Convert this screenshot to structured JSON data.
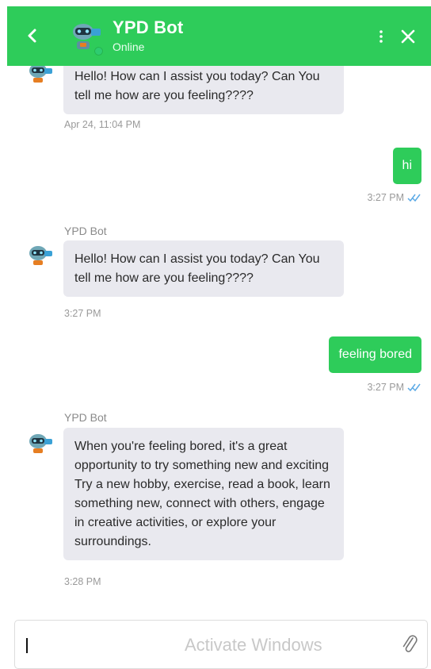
{
  "header": {
    "title": "YPD Bot",
    "status": "Online",
    "icons": {
      "back": "chevron-left-icon",
      "menu": "more-vertical-icon",
      "close": "close-icon",
      "avatar": "robot-avatar-icon"
    },
    "colors": {
      "header_bg": "#2ecc5a",
      "online": "#2ecc71"
    }
  },
  "messages": [
    {
      "from": "bot",
      "text": "Hello! How can I assist you today? Can You tell me how are you feeling????",
      "time": "Apr 24, 11:04 PM"
    },
    {
      "from": "user",
      "text": "hi",
      "time": "3:27 PM",
      "read": true
    },
    {
      "from": "bot",
      "sender": "YPD Bot",
      "text": "Hello! How can I assist you today? Can You tell me how are you feeling????",
      "time": "3:27 PM"
    },
    {
      "from": "user",
      "text": "feeling bored",
      "time": "3:27 PM",
      "read": true
    },
    {
      "from": "bot",
      "sender": "YPD Bot",
      "text": "When you're feeling bored, it's a great opportunity to try something new and exciting Try a new hobby, exercise, read a book, learn something new, connect with others, engage in creative activities, or explore your surroundings.",
      "time": "3:28 PM"
    }
  ],
  "composer": {
    "value": "",
    "watermark": "Activate Windows",
    "attach_icon": "paperclip-icon"
  },
  "colors": {
    "user_bubble": "#2ecc5a",
    "bot_bubble": "#e9e9ef",
    "read_ticks": "#5aa9e6"
  }
}
